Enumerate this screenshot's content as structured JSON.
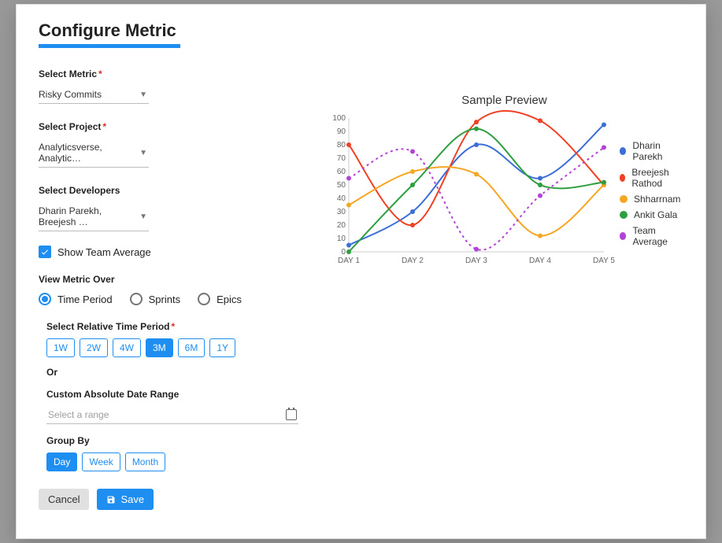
{
  "title": "Configure Metric",
  "labels": {
    "select_metric": "Select Metric",
    "select_project": "Select Project",
    "select_developers": "Select Developers",
    "show_team_avg": "Show Team Average",
    "view_metric_over": "View Metric Over",
    "select_rel_period": "Select Relative Time Period",
    "or": "Or",
    "custom_range": "Custom Absolute Date Range",
    "group_by": "Group By"
  },
  "metric": {
    "value": "Risky Commits"
  },
  "project": {
    "value": "Analyticsverse, Analytic…"
  },
  "developers": {
    "value": "Dharin Parekh, Breejesh …"
  },
  "team_avg_checked": true,
  "view_over": {
    "options": [
      "Time Period",
      "Sprints",
      "Epics"
    ],
    "selected": "Time Period"
  },
  "rel_period": {
    "options": [
      "1W",
      "2W",
      "4W",
      "3M",
      "6M",
      "1Y"
    ],
    "selected": "3M"
  },
  "date_range": {
    "placeholder": "Select a range"
  },
  "group_by": {
    "options": [
      "Day",
      "Week",
      "Month"
    ],
    "selected": "Day"
  },
  "buttons": {
    "cancel": "Cancel",
    "save": "Save"
  },
  "preview_title": "Sample Preview",
  "chart_data": {
    "type": "line",
    "title": "Sample Preview",
    "xlabel": "",
    "ylabel": "",
    "ylim": [
      0,
      100
    ],
    "yticks": [
      0,
      10,
      20,
      30,
      40,
      50,
      60,
      70,
      80,
      90,
      100
    ],
    "categories": [
      "DAY 1",
      "DAY 2",
      "DAY 3",
      "DAY 4",
      "DAY 5"
    ],
    "series": [
      {
        "name": "Dharin Parekh",
        "color": "#3b6fd6",
        "values": [
          5,
          30,
          80,
          55,
          95
        ]
      },
      {
        "name": "Breejesh Rathod",
        "color": "#ef4123",
        "values": [
          80,
          20,
          97,
          98,
          50
        ]
      },
      {
        "name": "Shharrnam",
        "color": "#f5a623",
        "values": [
          35,
          60,
          58,
          12,
          50
        ]
      },
      {
        "name": "Ankit Gala",
        "color": "#2e9e3f",
        "values": [
          0,
          50,
          92,
          50,
          52
        ]
      },
      {
        "name": "Team Average",
        "color": "#b342d6",
        "values": [
          55,
          75,
          2,
          42,
          78
        ],
        "dotted": true
      }
    ]
  }
}
